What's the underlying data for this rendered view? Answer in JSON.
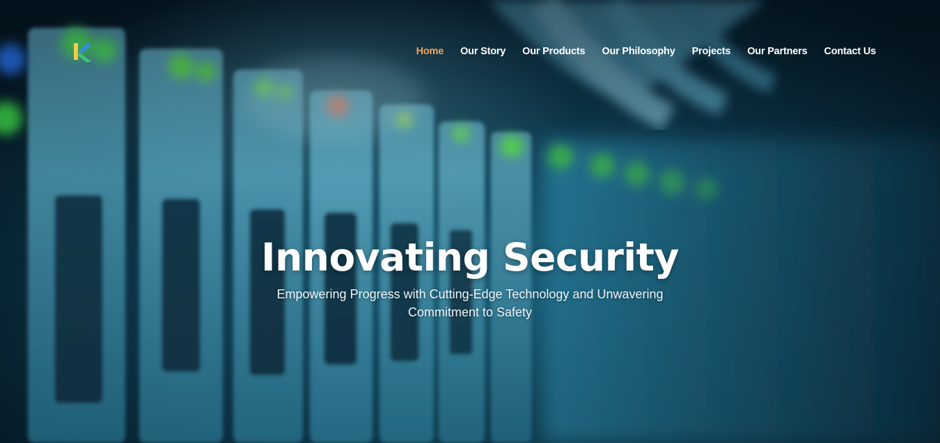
{
  "brand": {
    "logo_icon": "k-logo-icon",
    "colors": {
      "accent": "#f0a35e",
      "logo_yellow": "#f2c94c",
      "logo_blue": "#2f8fd8",
      "logo_green": "#3cc47c"
    }
  },
  "nav": {
    "items": [
      {
        "label": "Home",
        "active": true
      },
      {
        "label": "Our Story"
      },
      {
        "label": "Our Products"
      },
      {
        "label": "Our Philosophy"
      },
      {
        "label": "Projects"
      },
      {
        "label": "Our Partners"
      },
      {
        "label": "Contact Us"
      }
    ]
  },
  "hero": {
    "title": "Innovating Security",
    "subtitle": "Empowering Progress with Cutting-Edge Technology and Unwavering Commitment to Safety",
    "background": "server-rack-image"
  }
}
